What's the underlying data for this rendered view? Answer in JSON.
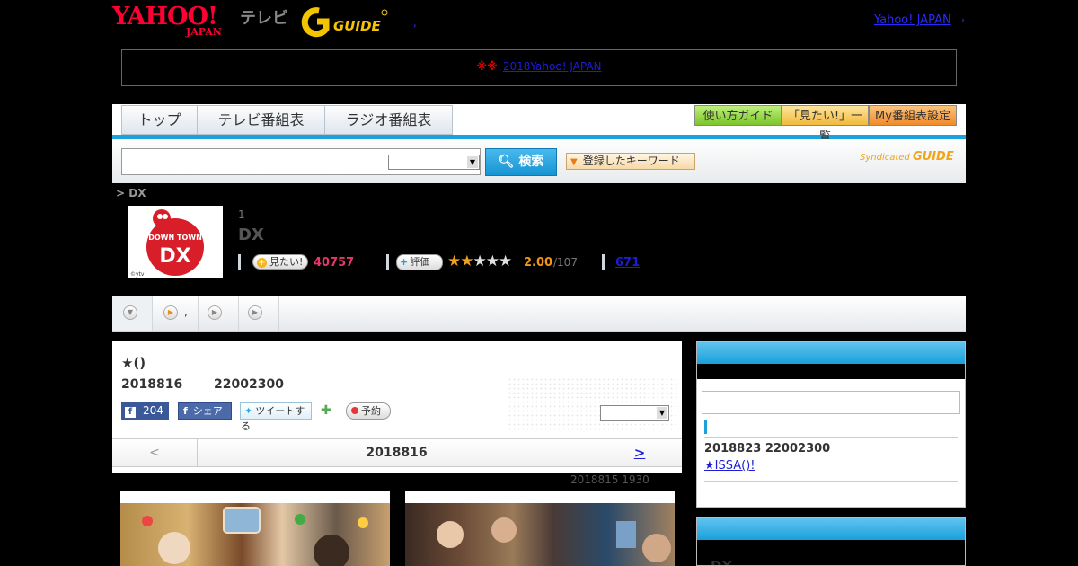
{
  "header": {
    "yahoo_logo": "YAHOO!",
    "yahoo_logo_sub": "JAPAN",
    "tv_label": "テレビ",
    "gguide_logo": "GUIDE",
    "left_dot": ",",
    "yahoo_japan_link": "Yahoo! JAPAN",
    "right_dot": ","
  },
  "notice": {
    "marks": "※※",
    "link_text": "2018Yahoo! JAPAN"
  },
  "nav": {
    "tabs": [
      {
        "label": "トップ"
      },
      {
        "label": "テレビ番組表"
      },
      {
        "label": "ラジオ番組表"
      }
    ],
    "guide_buttons": [
      {
        "label": "使い方ガイド",
        "color": "#8ed13a"
      },
      {
        "label": "「見たい!」一覧",
        "color": "#f5c24a"
      },
      {
        "label": "My番組表設定",
        "color": "#f39a33"
      }
    ]
  },
  "search": {
    "input_value": "",
    "button_label": "検索",
    "keyword_button": "登録したキーワード",
    "syndicated_label": "Syndicated",
    "syndicated_logo": "GUIDE"
  },
  "breadcrumb": "> DX",
  "program": {
    "thumbnail_top": "DOWN TOWN",
    "thumbnail_main": "DX",
    "thumbnail_credit": "©ytv",
    "rank": "1",
    "title": "DX",
    "want_label": "見たい!",
    "want_count": "40757",
    "rate_label": "評価",
    "rating": 2.0,
    "score": "2.00",
    "votes": "/107",
    "review_count": "671"
  },
  "sub_tabs": [
    {
      "label": ""
    },
    {
      "label": ","
    },
    {
      "label": ""
    },
    {
      "label": ""
    }
  ],
  "episode": {
    "title": "★()",
    "date": "2018816",
    "time": "22002300",
    "fb_like_count": "204",
    "fb_share_label": "シェア",
    "tweet_label": "ツイートする",
    "reserve_label": "予約",
    "pager_prev": "<",
    "pager_current": "2018816",
    "pager_next": ">",
    "aired_info": "2018815  1930"
  },
  "sidebar": {
    "next_datetime": "2018823  22002300",
    "next_link": "★ISSA()!",
    "second_box_title": "DX"
  },
  "colors": {
    "accent_blue": "#1ba2dd",
    "want_pink": "#e8366a",
    "score_orange": "#f0951d",
    "yahoo_red": "#ff0033"
  }
}
